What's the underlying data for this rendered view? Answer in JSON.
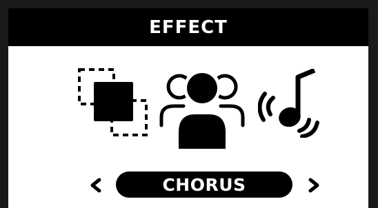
{
  "screen": {
    "title": "EFFECT"
  },
  "icons": [
    {
      "name": "layers-icon"
    },
    {
      "name": "ensemble-icon"
    },
    {
      "name": "music-note-vibrato-icon"
    }
  ],
  "selector": {
    "value": "CHORUS",
    "prev_icon": "chevron-left-icon",
    "next_icon": "chevron-right-icon"
  },
  "colors": {
    "foreground": "#000000",
    "background": "#ffffff"
  }
}
